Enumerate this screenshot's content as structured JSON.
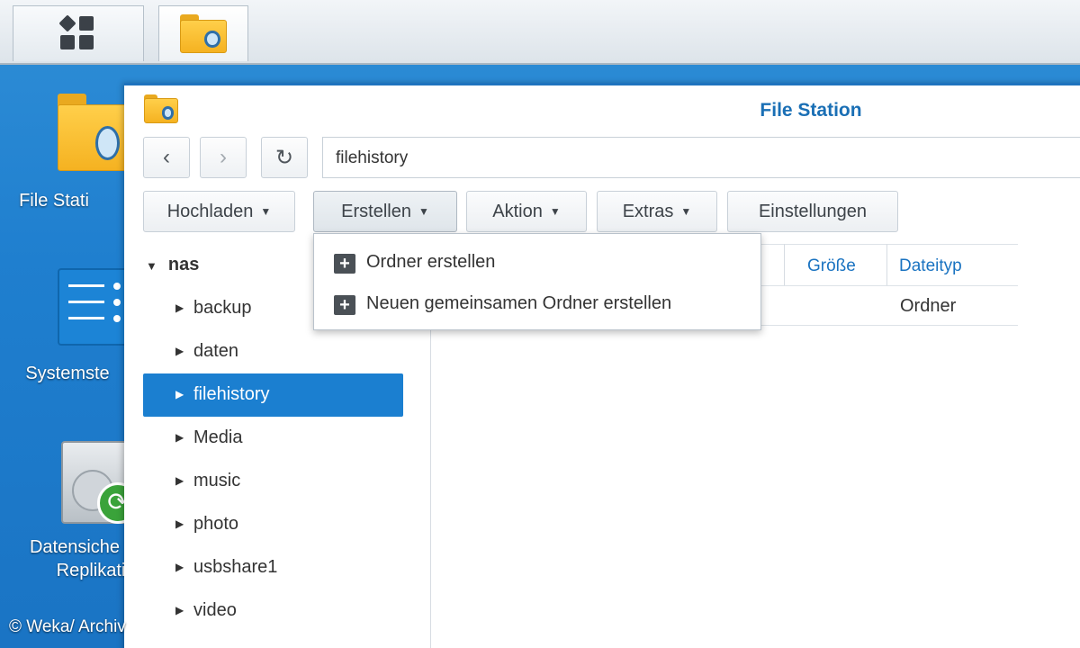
{
  "taskbar": {
    "main_menu_icon": "main-menu-grid-icon",
    "app_icon": "file-station-icon"
  },
  "desktop": {
    "icons": [
      {
        "label": "File Stati",
        "icon": "file-station-icon"
      },
      {
        "label": "Systemste",
        "icon": "control-panel-icon"
      },
      {
        "label_line1": "Datensiche",
        "label_line2": "Replikati",
        "icon": "backup-replication-icon"
      }
    ]
  },
  "window": {
    "title": "File Station",
    "nav": {
      "back": "‹",
      "forward": "›",
      "refresh": "↻"
    },
    "path": "filehistory",
    "toolbar": {
      "upload": "Hochladen",
      "create": "Erstellen",
      "action": "Aktion",
      "extras": "Extras",
      "settings": "Einstellungen"
    },
    "create_menu": [
      {
        "label": "Ordner erstellen",
        "icon": "plus-icon"
      },
      {
        "label": "Neuen gemeinsamen Ordner erstellen",
        "icon": "plus-icon"
      }
    ],
    "tree": {
      "root": "nas",
      "items": [
        "backup",
        "daten",
        "filehistory",
        "Media",
        "music",
        "photo",
        "usbshare1",
        "video"
      ],
      "selected": "filehistory"
    },
    "file_list": {
      "columns": [
        "Größe",
        "Dateityp"
      ],
      "rows": [
        {
          "size": "",
          "type": "Ordner"
        }
      ]
    }
  },
  "watermark": "© Weka/ Archiv",
  "colors": {
    "accent": "#1b7fd0",
    "title": "#1a6fb5",
    "desktop": "#1f7fcf"
  }
}
